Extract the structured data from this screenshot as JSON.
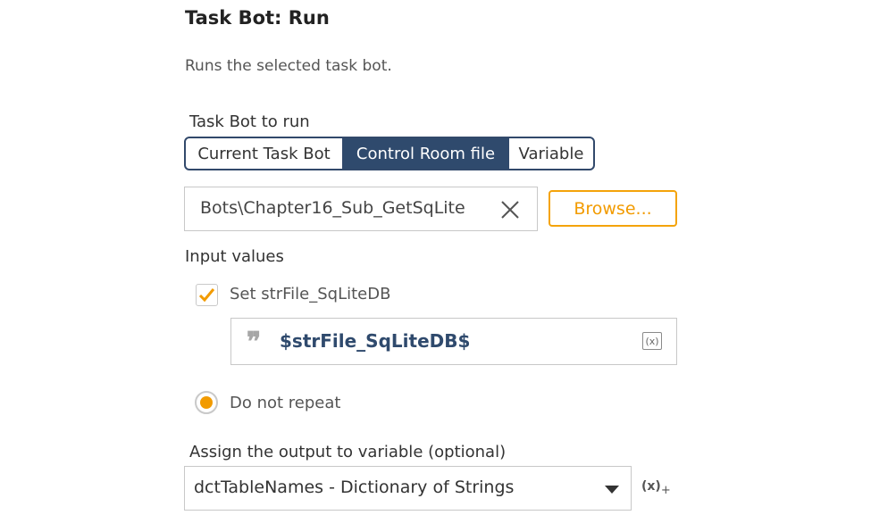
{
  "panel": {
    "title": "Task Bot: Run",
    "description": "Runs the selected task bot."
  },
  "task_bot_to_run": {
    "label": "Task Bot to run",
    "options": [
      "Current Task Bot",
      "Control Room file",
      "Variable"
    ],
    "selected": "Control Room file"
  },
  "file_path": {
    "value": "Bots\\Chapter16_Sub_GetSqLite",
    "clear_icon": "close-icon",
    "browse_label": "Browse..."
  },
  "input_values": {
    "label": "Input values",
    "checkbox_label": "Set strFile_SqLiteDB",
    "checked": true,
    "expression": "$strFile_SqLiteDB$",
    "quote_glyph": "❞",
    "var_icon_text": "(x)"
  },
  "repeat": {
    "label": "Do not repeat",
    "selected": true
  },
  "output": {
    "label": "Assign the output to variable (optional)",
    "selected_value": "dctTableNames - Dictionary of Strings",
    "insert_icon_text": "(x)",
    "insert_icon_sub": "+"
  },
  "colors": {
    "accent": "#f29b00",
    "navy": "#2f4a6d"
  }
}
